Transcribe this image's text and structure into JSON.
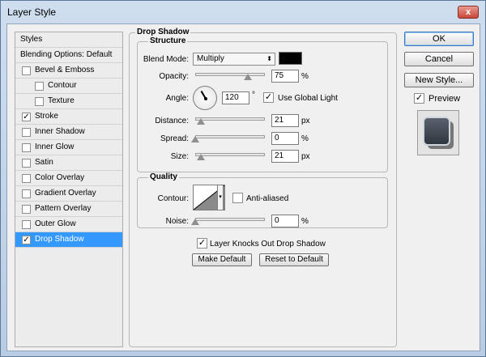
{
  "window": {
    "title": "Layer Style",
    "close_glyph": "x"
  },
  "styles_panel": {
    "header": "Styles",
    "blending": "Blending Options: Default",
    "items": [
      {
        "label": "Bevel & Emboss",
        "checked": false,
        "indent": 0
      },
      {
        "label": "Contour",
        "checked": false,
        "indent": 1
      },
      {
        "label": "Texture",
        "checked": false,
        "indent": 1
      },
      {
        "label": "Stroke",
        "checked": true,
        "indent": 0
      },
      {
        "label": "Inner Shadow",
        "checked": false,
        "indent": 0
      },
      {
        "label": "Inner Glow",
        "checked": false,
        "indent": 0
      },
      {
        "label": "Satin",
        "checked": false,
        "indent": 0
      },
      {
        "label": "Color Overlay",
        "checked": false,
        "indent": 0
      },
      {
        "label": "Gradient Overlay",
        "checked": false,
        "indent": 0
      },
      {
        "label": "Pattern Overlay",
        "checked": false,
        "indent": 0
      },
      {
        "label": "Outer Glow",
        "checked": false,
        "indent": 0
      },
      {
        "label": "Drop Shadow",
        "checked": true,
        "indent": 0,
        "selected": true
      }
    ]
  },
  "drop_shadow": {
    "title": "Drop Shadow",
    "structure": {
      "title": "Structure",
      "blend_mode_label": "Blend Mode:",
      "blend_mode_value": "Multiply",
      "blend_color": "#000000",
      "opacity_label": "Opacity:",
      "opacity_value": "75",
      "opacity_fraction": 0.75,
      "opacity_unit": "%",
      "angle_label": "Angle:",
      "angle_value": "120",
      "angle_unit": "°",
      "global_light_label": "Use Global Light",
      "global_light_checked": true,
      "distance_label": "Distance:",
      "distance_value": "21",
      "distance_fraction": 0.08,
      "distance_unit": "px",
      "spread_label": "Spread:",
      "spread_value": "0",
      "spread_fraction": 0,
      "spread_unit": "%",
      "size_label": "Size:",
      "size_value": "21",
      "size_fraction": 0.08,
      "size_unit": "px"
    },
    "quality": {
      "title": "Quality",
      "contour_label": "Contour:",
      "anti_aliased_label": "Anti-aliased",
      "anti_aliased_checked": false,
      "noise_label": "Noise:",
      "noise_value": "0",
      "noise_fraction": 0,
      "noise_unit": "%"
    },
    "knocks_out_label": "Layer Knocks Out Drop Shadow",
    "knocks_out_checked": true,
    "make_default_label": "Make Default",
    "reset_default_label": "Reset to Default"
  },
  "buttons": {
    "ok": "OK",
    "cancel": "Cancel",
    "new_style": "New Style...",
    "preview_label": "Preview",
    "preview_checked": true
  },
  "icons": {
    "check": "✓",
    "dropdown_arrow": "⬍",
    "contour_arrow": "▾"
  }
}
